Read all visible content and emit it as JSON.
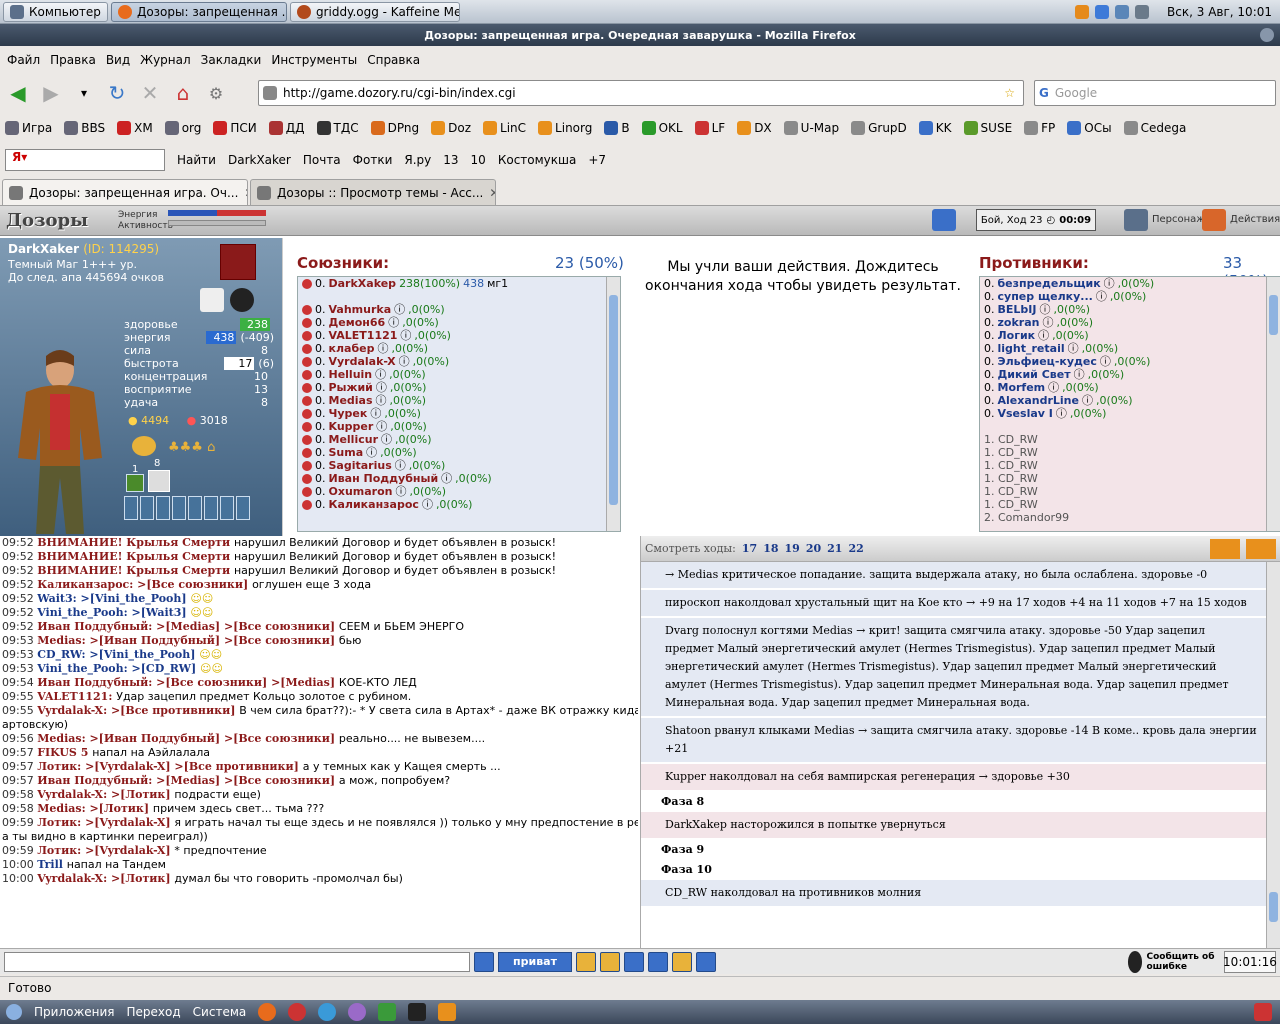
{
  "taskbar": {
    "computer": "Компьютер",
    "task1": "Дозоры: запрещенная ...",
    "task2": "griddy.ogg - Kaffeine Me...",
    "clock": "Вск, 3 Авг, 10:01"
  },
  "window_title": "Дозоры: запрещенная игра. Очередная заварушка - Mozilla Firefox",
  "menu": [
    "Файл",
    "Правка",
    "Вид",
    "Журнал",
    "Закладки",
    "Инструменты",
    "Справка"
  ],
  "url": "http://game.dozory.ru/cgi-bin/index.cgi",
  "search_placeholder": "Google",
  "bookmarks": [
    "Игра",
    "BBS",
    "ХМ",
    "org",
    "ПСИ",
    "ДД",
    "ТДС",
    "DPng",
    "Doz",
    "LinC",
    "Linorg",
    "B",
    "OKL",
    "LF",
    "DX",
    "U-Map",
    "GrupD",
    "KK",
    "SUSE",
    "FP",
    "ОСы",
    "Cedega"
  ],
  "yabar": {
    "find": "Найти",
    "user": "DarkXaker",
    "mail": "Почта",
    "photo": "Фотки",
    "yaru": "Я.ру",
    "n13": "13",
    "n10": "10",
    "city": "Костомукша",
    "temp": "+7"
  },
  "tabs": [
    "Дозоры: запрещенная игра. Оч...",
    "Дозоры :: Просмотр темы - Асс..."
  ],
  "game_header": {
    "logo": "Дозоры",
    "energy_label": "Энергия",
    "activity_label": "Активность",
    "turn": "Бой, Ход 23",
    "timer": "00:09",
    "person": "Персонаж",
    "actions": "Действия"
  },
  "character": {
    "name": "DarkXaker",
    "id": "(ID: 114295)",
    "rank": "Темный Маг 1+++ ур.",
    "next": "До след. апа 445694 очков",
    "stats": [
      {
        "k": "здоровье",
        "v": "238",
        "x": ""
      },
      {
        "k": "энергия",
        "v": "438",
        "x": "(-409)"
      },
      {
        "k": "сила",
        "v": "8",
        "x": ""
      },
      {
        "k": "быстрота",
        "v": "17",
        "x": "(6)"
      },
      {
        "k": "концентрация",
        "v": "10",
        "x": ""
      },
      {
        "k": "восприятие",
        "v": "13",
        "x": ""
      },
      {
        "k": "удача",
        "v": "8",
        "x": ""
      }
    ],
    "money1": "4494",
    "money2": "3018",
    "lvl1": "1",
    "lvl2": "8"
  },
  "allies": {
    "title": "Союзники:",
    "count": "23 (50%)",
    "me": {
      "name": "DarkXakep",
      "hp": "238(100%)",
      "en": "438",
      "mg": "мг1"
    },
    "list": [
      "Vahmurka",
      "Демон66",
      "VALET1121",
      "клабер",
      "Vyrdalak-X",
      "Helluin",
      "Рыжий",
      "Medias",
      "Чурек",
      "Kupper",
      "Mellicur",
      "Suma",
      "Sagitarius",
      "Иван Поддубный",
      "Oxumaron",
      "Каликанзарос"
    ]
  },
  "message": "Мы учли ваши действия. Дождитесь окончания хода чтобы увидеть результат.",
  "enemies": {
    "title": "Противники:",
    "count": "33 (50%)",
    "list": [
      "безпредельщик",
      "супер щелку...",
      "BELbIJ",
      "zokran",
      "Логик",
      "light_retail",
      "Эльфиец-кудес",
      "Дикий Свет",
      "Morfem",
      "AlexandrLine",
      "Vseslav I"
    ],
    "queue": [
      "1. CD_RW",
      "1. CD_RW",
      "1. CD_RW",
      "1. CD_RW",
      "1. CD_RW",
      "1. CD_RW",
      "2. Comandor99"
    ]
  },
  "chat": [
    {
      "t": "09:52",
      "n": "ВНИМАНИЕ! Крылья Смерти",
      "m": "нарушил Великий Договор и будет объявлен в розыск!"
    },
    {
      "t": "09:52",
      "n": "ВНИМАНИЕ! Крылья Смерти",
      "m": "нарушил Великий Договор и будет объявлен в розыск!"
    },
    {
      "t": "09:52",
      "n": "ВНИМАНИЕ! Крылья Смерти",
      "m": "нарушил Великий Договор и будет объявлен в розыск!"
    },
    {
      "t": "09:52",
      "n": "Каликанзарос: >[Все союзники]",
      "m": "оглушен еще 3 хода"
    },
    {
      "t": "09:52",
      "n": "Wait3: >[Vini_the_Pooh]",
      "m": ""
    },
    {
      "t": "09:52",
      "n": "Vini_the_Pooh: >[Wait3]",
      "m": ""
    },
    {
      "t": "09:52",
      "n": "Иван Поддубный: >[Medias] >[Все союзники]",
      "m": "СЕЕМ и БЬЕМ ЭНЕРГО"
    },
    {
      "t": "09:53",
      "n": "Medias: >[Иван Поддубный] >[Все союзники]",
      "m": "бью"
    },
    {
      "t": "09:53",
      "n": "CD_RW: >[Vini_the_Pooh]",
      "m": ""
    },
    {
      "t": "09:53",
      "n": "Vini_the_Pooh: >[CD_RW]",
      "m": ""
    },
    {
      "t": "09:54",
      "n": "Иван Поддубный: >[Все союзники] >[Medias]",
      "m": "КОЕ-КТО ЛЕД"
    },
    {
      "t": "09:55",
      "n": "VALET1121:",
      "m": "Удар зацепил предмет Кольцо золотое с рубином."
    },
    {
      "t": "09:55",
      "n": "Vyrdalak-X: >[Все противники]",
      "m": "В чем сила брат??):- * У света сила в Артах* - даже ВК отражку кидает"
    },
    {
      "t": "",
      "n": "",
      "m": "артовскую)"
    },
    {
      "t": "09:56",
      "n": "Medias: >[Иван Поддубный] >[Все союзники]",
      "m": "реально.... не вывезем...."
    },
    {
      "t": "09:57",
      "n": "FIKUS 5",
      "m": "напал на Аэйлалала"
    },
    {
      "t": "09:57",
      "n": "Лотик: >[Vyrdalak-X] >[Все противники]",
      "m": "а у темных как у Кащея смерть ..."
    },
    {
      "t": "09:57",
      "n": "Иван Поддубный: >[Medias] >[Все союзники]",
      "m": "а мож, попробуем?"
    },
    {
      "t": "09:58",
      "n": "Vyrdalak-X: >[Лотик]",
      "m": "подрасти еще)"
    },
    {
      "t": "09:58",
      "n": "Medias: >[Лотик]",
      "m": "причем здесь свет... тьма ???"
    },
    {
      "t": "09:59",
      "n": "Лотик: >[Vyrdalak-X]",
      "m": "я играть начал ты еще здесь и не появлялся )) только у мну предпостение в реал ушло)"
    },
    {
      "t": "",
      "n": "",
      "m": "а ты видно в картинки переиграл))"
    },
    {
      "t": "09:59",
      "n": "Лотик: >[Vyrdalak-X]",
      "m": "* предпочтение"
    },
    {
      "t": "10:00",
      "n": "Trill",
      "m": "напал на Тандем"
    },
    {
      "t": "10:00",
      "n": "Vyrdalak-X: >[Лотик]",
      "m": "думал бы что говорить -промолчал бы)"
    }
  ],
  "log": {
    "watch": "Смотреть ходы:",
    "turns": [
      "17",
      "18",
      "19",
      "20",
      "21",
      "22"
    ],
    "entries": [
      {
        "a": "Medias",
        "t": "→ Medias критическое попадание. защита выдержала атаку, но была ослаблена. здоровье -0"
      },
      {
        "a": "пироскоп",
        "t": "пироскоп наколдовал хрустальный щит на Кое кто → +9 на 17 ходов  +4 на 11 ходов  +7 на 15 ходов"
      },
      {
        "a": "Dvarg",
        "t": "Dvarg полоснул когтями Medias → крит! защита смягчила атаку. здоровье -50 Удар зацепил предмет Малый энергетический амулет (Hermes Trismegistus). Удар зацепил предмет Малый энергетический амулет (Hermes Trismegistus). Удар зацепил предмет Малый энергетический амулет (Hermes Trismegistus). Удар зацепил предмет Минеральная вода. Удар зацепил предмет Минеральная вода. Удар зацепил предмет Минеральная вода."
      },
      {
        "a": "Shatoon",
        "t": "Shatoon рванул клыками Medias → защита смягчила атаку. здоровье -14 В коме.. кровь дала энергии +21"
      },
      {
        "a": "Kupper",
        "t": "Kupper наколдовал на себя вампирская регенерация → здоровье +30"
      }
    ],
    "phase8": "Фаза 8",
    "dark": "DarkXakep насторожился в попытке увернуться",
    "phase9": "Фаза 9",
    "phase10": "Фаза 10",
    "last": "CD_RW наколдовал на противников молния"
  },
  "bottom": {
    "private": "приват",
    "report": "Сообщить об ошибке",
    "time": "10:01:16"
  },
  "status": "Готово",
  "gnome": {
    "apps": "Приложения",
    "go": "Переход",
    "system": "Система"
  }
}
